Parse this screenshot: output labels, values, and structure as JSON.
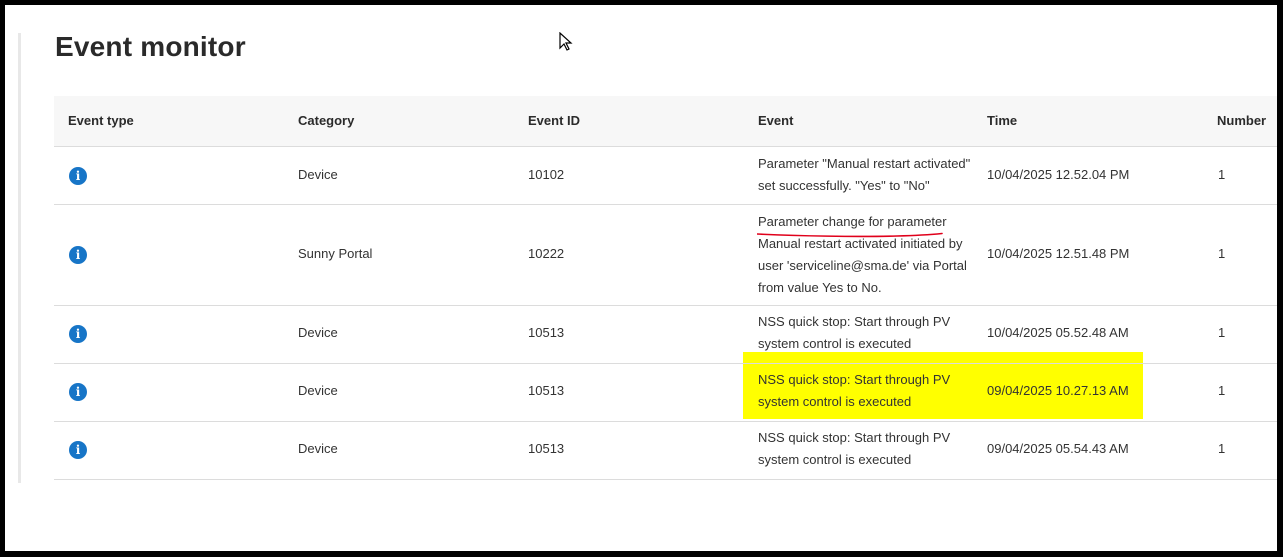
{
  "page": {
    "title": "Event monitor"
  },
  "table": {
    "headers": [
      "Event type",
      "Category",
      "Event ID",
      "Event",
      "Time",
      "Number"
    ],
    "rows": [
      {
        "event_type": "info-icon",
        "category": "Device",
        "event_id": "10102",
        "event_lines": [
          "Parameter \"Manual restart activated\"",
          "set successfully. \"Yes\" to \"No\""
        ],
        "time": "10/04/2025 12.52.04 PM",
        "number": "1"
      },
      {
        "event_type": "info-icon",
        "category": "Sunny Portal",
        "event_id": "10222",
        "event_lines": [
          "Parameter change for parameter",
          "Manual restart activated initiated by",
          "user 'serviceline@sma.de' via Portal",
          "from value Yes to No."
        ],
        "time": "10/04/2025 12.51.48 PM",
        "number": "1"
      },
      {
        "event_type": "info-icon",
        "category": "Device",
        "event_id": "10513",
        "event_lines": [
          "NSS quick stop: Start through PV",
          "system control is executed"
        ],
        "time": "10/04/2025 05.52.48 AM",
        "number": "1"
      },
      {
        "event_type": "info-icon",
        "category": "Device",
        "event_id": "10513",
        "event_lines": [
          "NSS quick stop: Start through PV",
          "system control is executed"
        ],
        "time": "09/04/2025 10.27.13 AM",
        "number": "1"
      },
      {
        "event_type": "info-icon",
        "category": "Device",
        "event_id": "10513",
        "event_lines": [
          "NSS quick stop: Start through PV",
          "system control is executed"
        ],
        "time": "09/04/2025 05.54.43 AM",
        "number": "1"
      }
    ]
  },
  "annotations": {
    "highlight_color": "#ffff00",
    "underline_color": "#e0001b"
  },
  "colors": {
    "info_icon": "#1775c7"
  },
  "icons": {
    "info": "i"
  }
}
